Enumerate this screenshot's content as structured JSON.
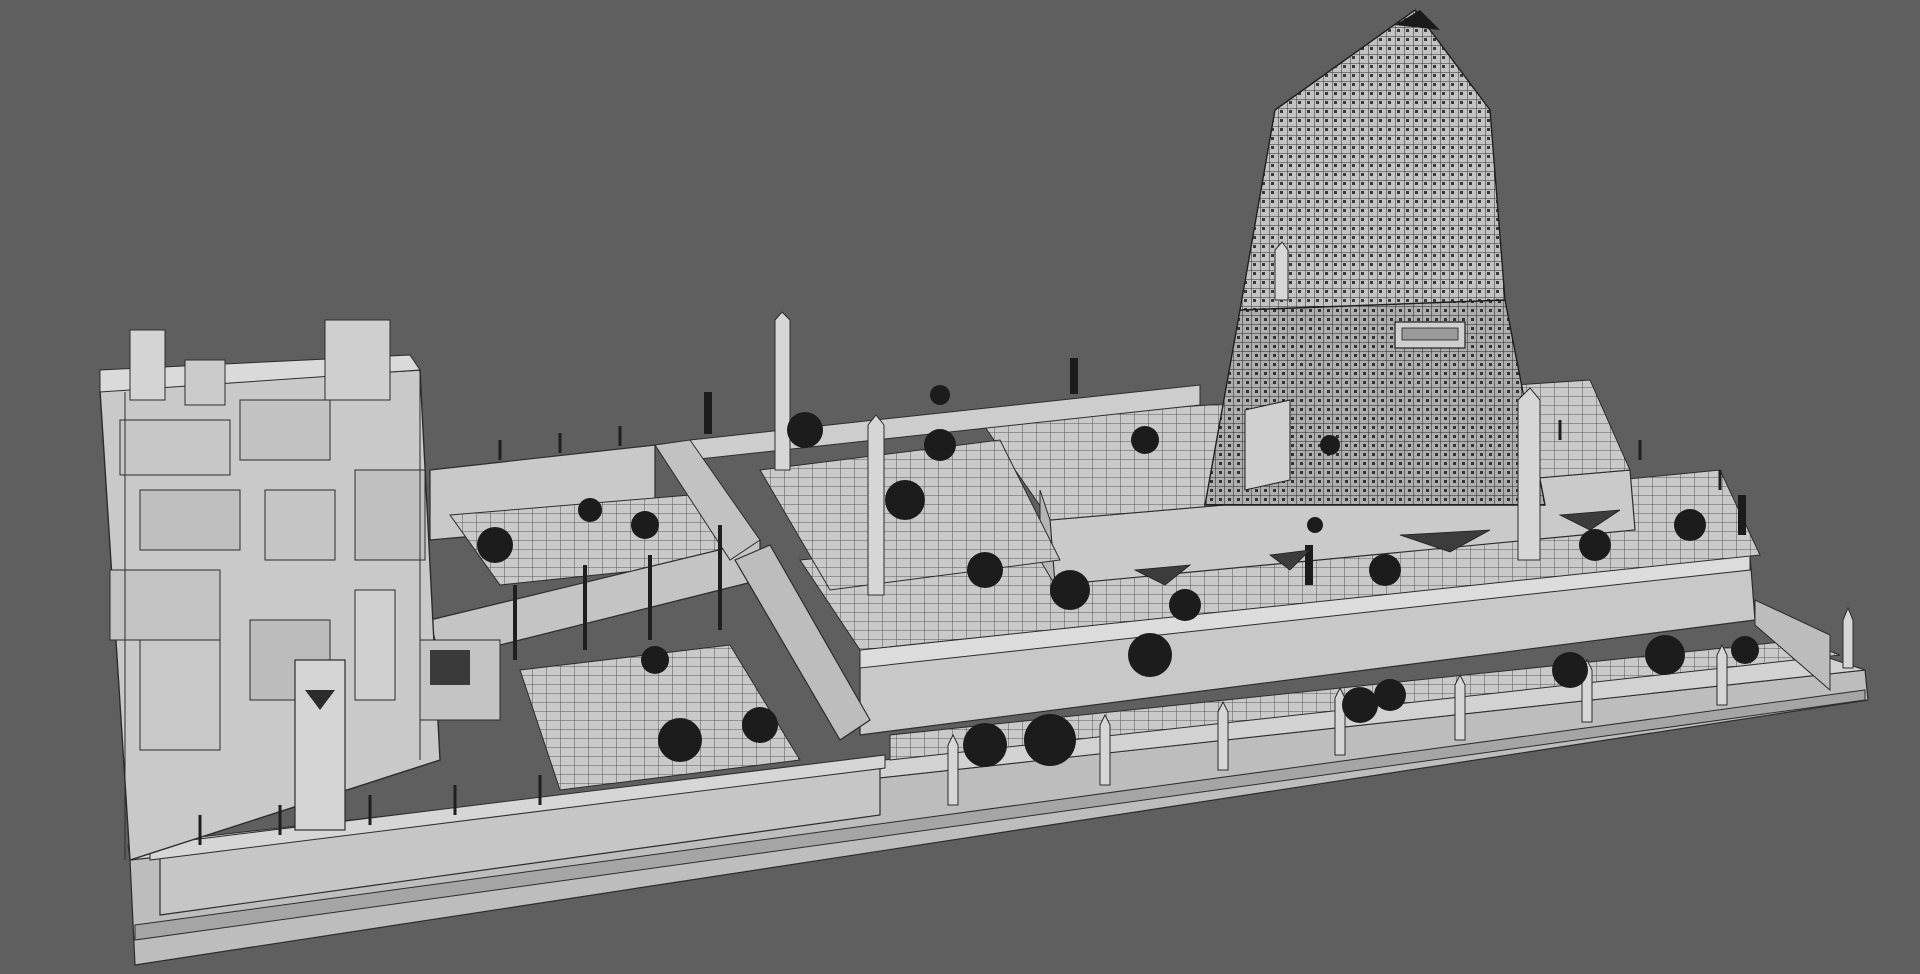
{
  "viewport": {
    "background_color": "#5f5f5f",
    "render_style": "clay-wireframe",
    "subject": "temple-complex-with-pyramid"
  },
  "palette": {
    "clay_light": "#cfcfcf",
    "clay_mid": "#b9b9b9",
    "clay_dark": "#9b9b9b",
    "wire": "#2c2c2c",
    "foliage": "#1c1c1c"
  }
}
